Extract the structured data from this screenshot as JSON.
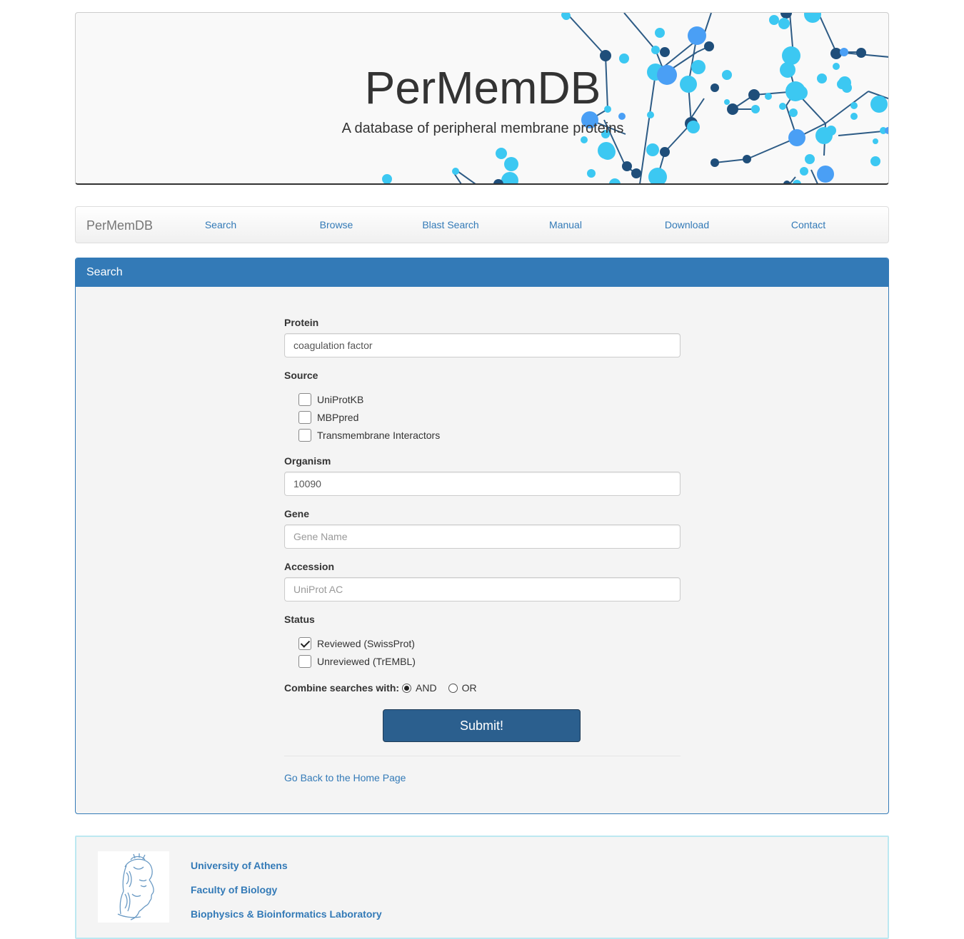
{
  "banner": {
    "title": "PerMemDB",
    "subtitle": "A database of peripheral membrane proteins"
  },
  "navbar": {
    "brand": "PerMemDB",
    "items": [
      "Search",
      "Browse",
      "Blast Search",
      "Manual",
      "Download",
      "Contact"
    ]
  },
  "panel": {
    "title": "Search"
  },
  "form": {
    "protein": {
      "label": "Protein",
      "value": "coagulation factor"
    },
    "source": {
      "label": "Source",
      "options": [
        {
          "label": "UniProtKB",
          "checked": false
        },
        {
          "label": "MBPpred",
          "checked": false
        },
        {
          "label": "Transmembrane Interactors",
          "checked": false
        }
      ]
    },
    "organism": {
      "label": "Organism",
      "value": "10090"
    },
    "gene": {
      "label": "Gene",
      "placeholder": "Gene Name"
    },
    "accession": {
      "label": "Accession",
      "placeholder": "UniProt AC"
    },
    "status": {
      "label": "Status",
      "options": [
        {
          "label": "Reviewed (SwissProt)",
          "checked": true
        },
        {
          "label": "Unreviewed (TrEMBL)",
          "checked": false
        }
      ]
    },
    "combine": {
      "label": "Combine searches with:",
      "options": [
        {
          "label": "AND",
          "selected": true
        },
        {
          "label": "OR",
          "selected": false
        }
      ]
    },
    "submit_label": "Submit!",
    "back_link": "Go Back to the Home Page"
  },
  "footer": {
    "lines": [
      "University of Athens",
      "Faculty of Biology",
      "Biophysics & Bioinformatics Laboratory"
    ],
    "logo_icon": "athena-head-logo-icon"
  },
  "colors": {
    "primary": "#337ab7",
    "submit": "#2b5f8e",
    "network_light": "#3cc8f2",
    "network_mid": "#4a9ff5",
    "network_dark": "#1f4e7a"
  }
}
